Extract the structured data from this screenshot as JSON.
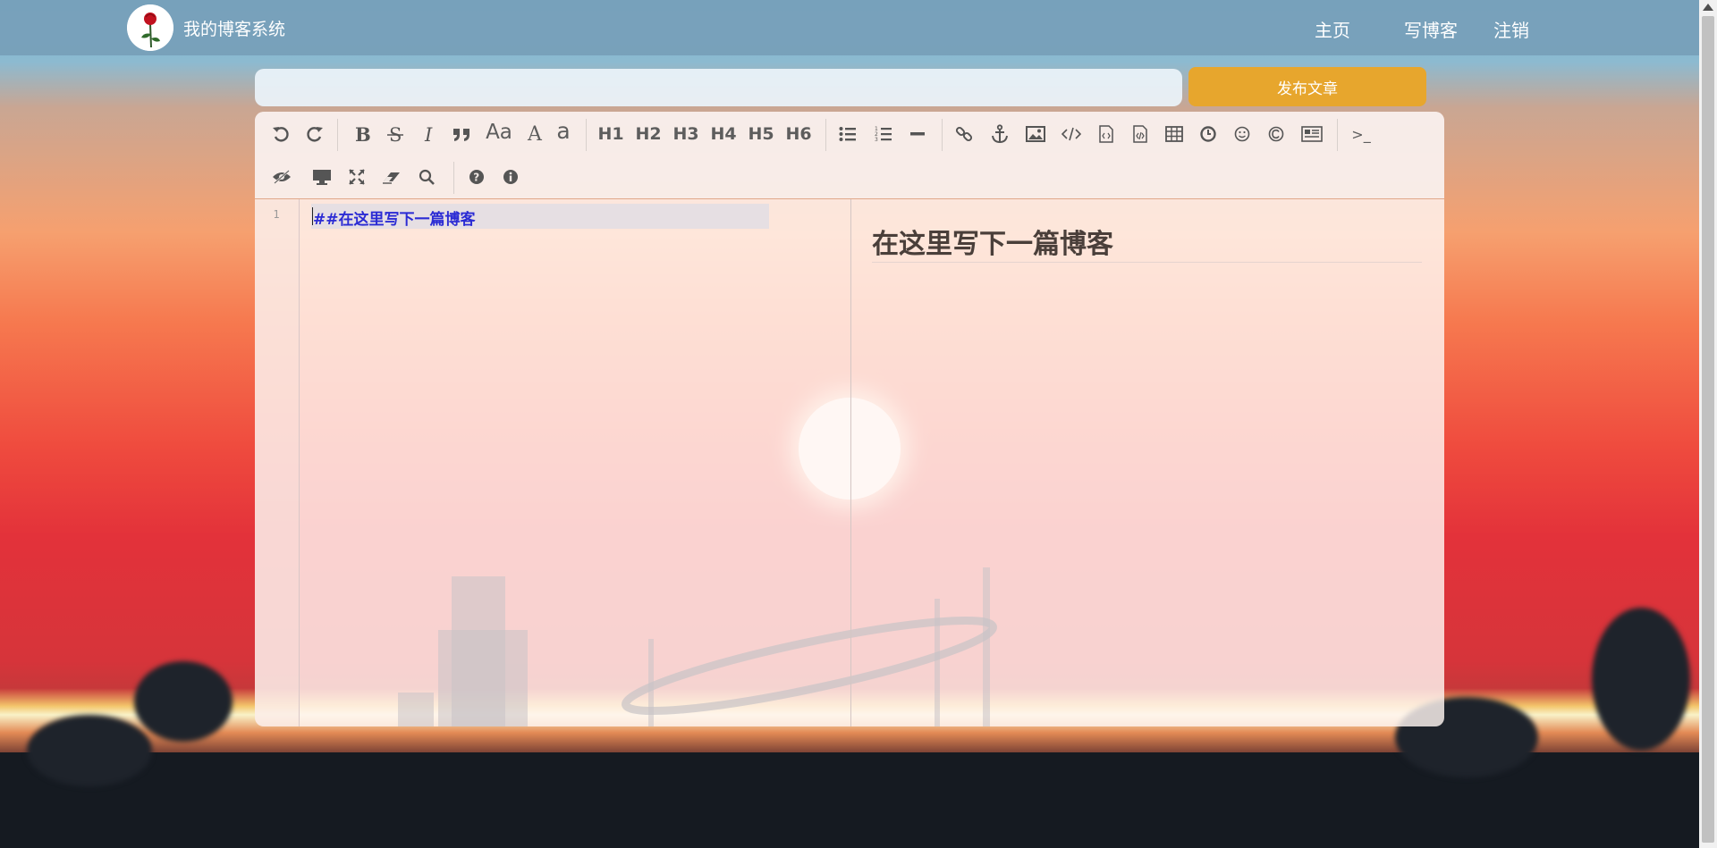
{
  "nav": {
    "site_title": "我的博客系统",
    "links": [
      "主页",
      "写博客",
      "注销"
    ]
  },
  "title_row": {
    "title_value": "",
    "title_placeholder": "",
    "publish_label": "发布文章"
  },
  "toolbar": {
    "row1": [
      "undo-icon",
      "redo-icon",
      "bold-icon",
      "strikethrough-icon",
      "italic-icon",
      "quote-icon",
      "uppercase-icon",
      "uppercase-first-icon",
      "lowercase-icon",
      "H1",
      "H2",
      "H3",
      "H4",
      "H5",
      "H6",
      "unordered-list-icon",
      "ordered-list-icon",
      "horizontal-rule-icon",
      "link-icon",
      "anchor-icon",
      "image-icon",
      "code-icon",
      "preformatted-code-icon",
      "code-block-icon",
      "table-icon",
      "datetime-icon",
      "emoji-icon",
      "html-entities-icon",
      "pagebreak-icon",
      "terminal-icon"
    ],
    "row2": [
      "toggle-preview-icon",
      "desktop-icon",
      "fullscreen-icon",
      "clear-icon",
      "search-icon",
      "help-icon",
      "info-icon"
    ],
    "heading_labels": [
      "H1",
      "H2",
      "H3",
      "H4",
      "H5",
      "H6"
    ],
    "text_glyphs": {
      "uppercase": "Aa",
      "upper_first": "A",
      "lowercase": "a",
      "terminal": ">_"
    }
  },
  "editor": {
    "line_number": "1",
    "content": "##在这里写下一篇博客"
  },
  "preview": {
    "heading": "在这里写下一篇博客"
  },
  "colors": {
    "nav_bg": "#78a0b9",
    "publish_bg": "#e7a62d",
    "code_text": "#2b2bd4"
  }
}
